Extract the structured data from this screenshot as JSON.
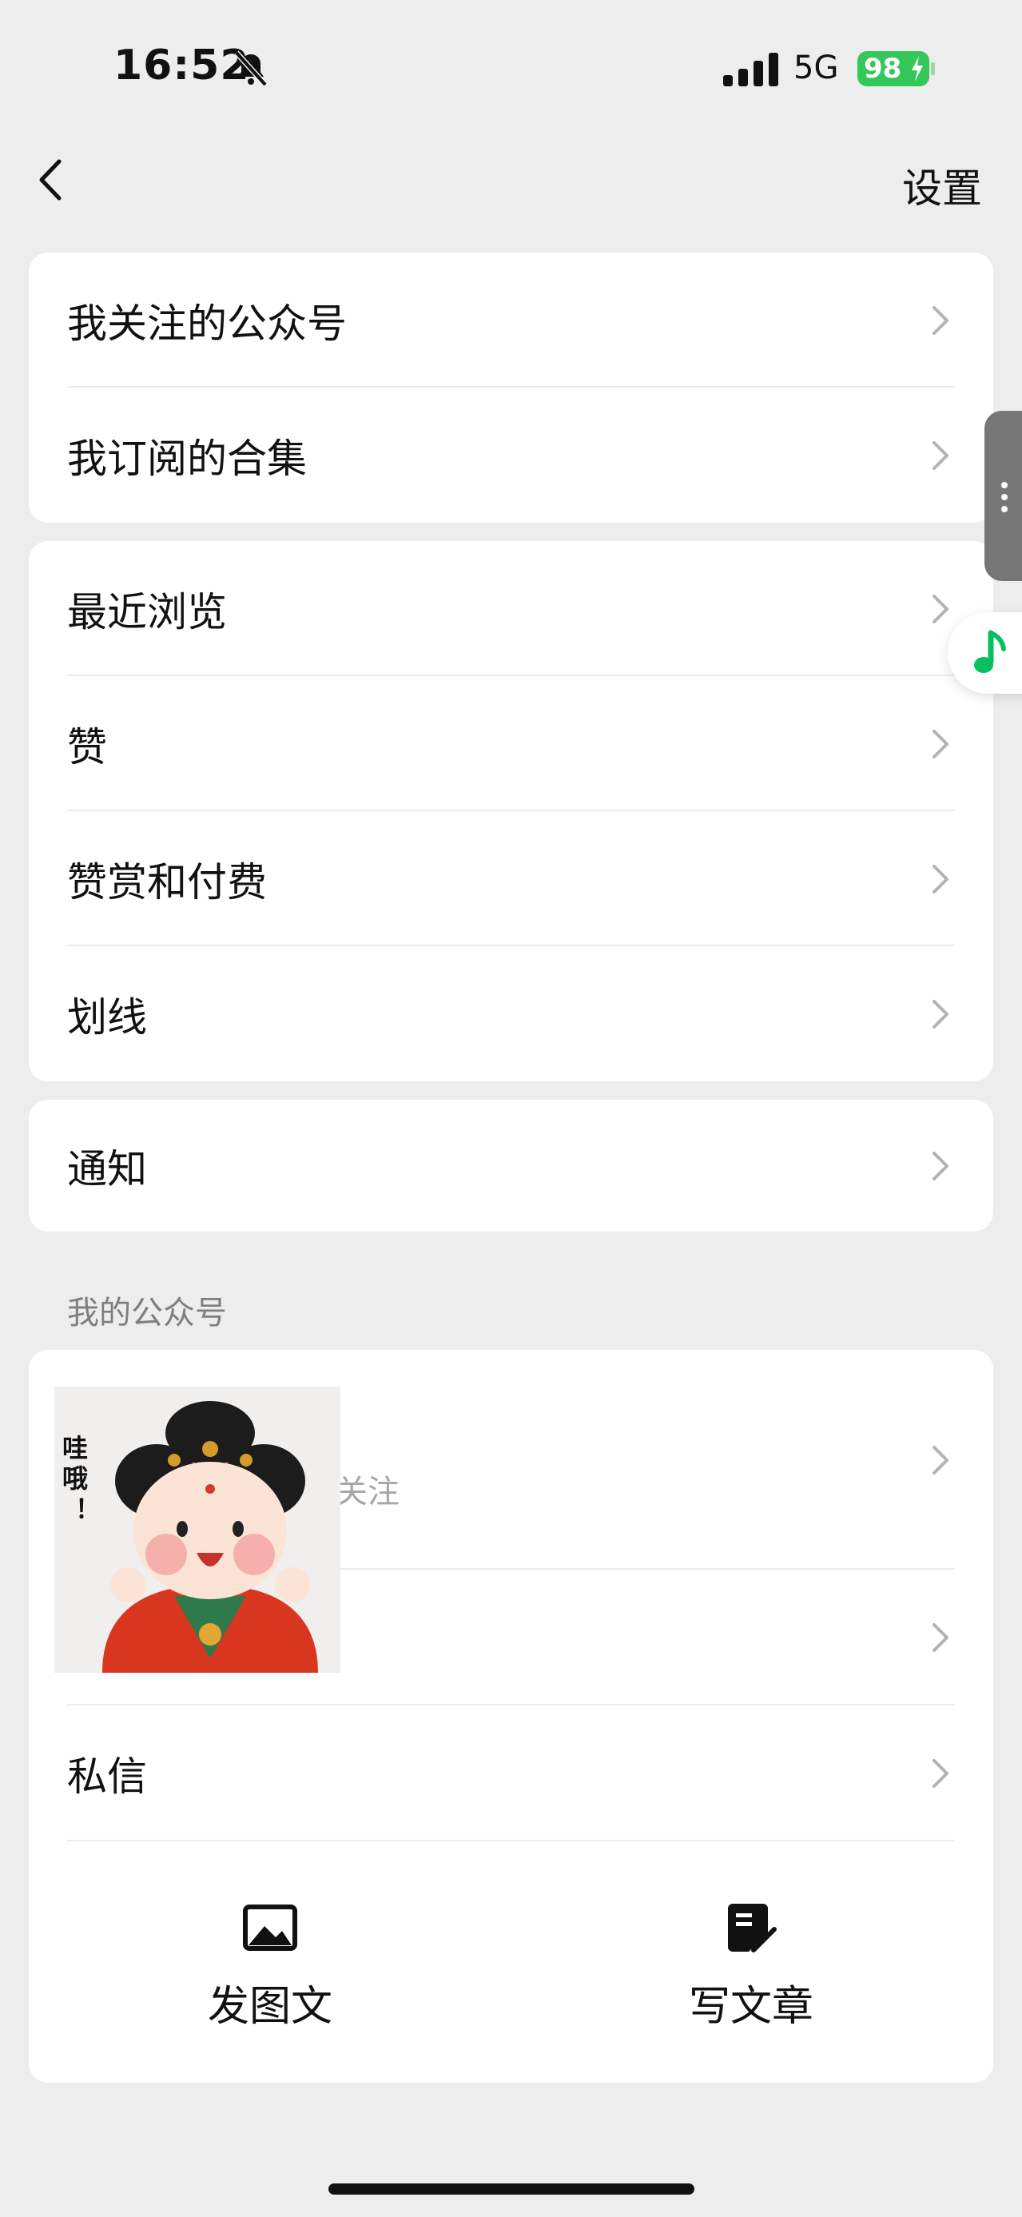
{
  "status_bar": {
    "time": "16:52",
    "network": "5G",
    "battery": "98"
  },
  "nav": {
    "settings_label": "设置"
  },
  "group1": {
    "items": [
      {
        "label": "我关注的公众号"
      },
      {
        "label": "我订阅的合集"
      }
    ]
  },
  "group2": {
    "items": [
      {
        "label": "最近浏览"
      },
      {
        "label": "赞"
      },
      {
        "label": "赞赏和付费"
      },
      {
        "label": "划线"
      }
    ]
  },
  "group3": {
    "items": [
      {
        "label": "通知"
      }
    ]
  },
  "my_account": {
    "section_title": "我的公众号",
    "avatar_caption": "哇哦！",
    "follow_text": "关注",
    "private_message_label": "私信",
    "actions": [
      {
        "label": "发图文",
        "icon": "image-icon"
      },
      {
        "label": "写文章",
        "icon": "edit-note-icon"
      }
    ]
  },
  "colors": {
    "accent": "#07c160",
    "battery": "#34c759",
    "background": "#ededed"
  }
}
